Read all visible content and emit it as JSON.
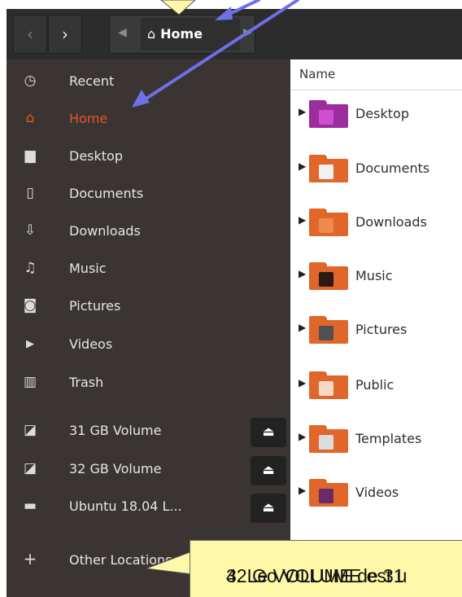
{
  "header": {
    "back_icon": "chevron-left-icon",
    "back_glyph": "‹",
    "forward_icon": "chevron-right-icon",
    "forward_glyph": "›",
    "path_left_glyph": "◀",
    "path_right_glyph": "▶",
    "home_icon": "home-icon",
    "home_glyph": "⌂",
    "current_location": "Home"
  },
  "sidebar": {
    "items": [
      {
        "label": "Recent",
        "icon": "clock-icon",
        "glyph": "◷"
      },
      {
        "label": "Home",
        "icon": "home-icon",
        "glyph": "⌂",
        "active": true
      },
      {
        "label": "Desktop",
        "icon": "desktop-folder-icon",
        "glyph": "▆"
      },
      {
        "label": "Documents",
        "icon": "document-icon",
        "glyph": "▯"
      },
      {
        "label": "Downloads",
        "icon": "download-icon",
        "glyph": "⇩"
      },
      {
        "label": "Music",
        "icon": "music-icon",
        "glyph": "♫"
      },
      {
        "label": "Pictures",
        "icon": "camera-icon",
        "glyph": "◙"
      },
      {
        "label": "Videos",
        "icon": "video-icon",
        "glyph": "▶"
      },
      {
        "label": "Trash",
        "icon": "trash-icon",
        "glyph": "▥"
      }
    ],
    "devices": [
      {
        "label": "31 GB Volume",
        "icon": "drive-icon",
        "glyph": "◪",
        "eject_icon": "eject-icon",
        "eject_glyph": "⏏"
      },
      {
        "label": "32 GB Volume",
        "icon": "drive-icon",
        "glyph": "◪",
        "eject_icon": "eject-icon",
        "eject_glyph": "⏏"
      },
      {
        "label": "Ubuntu 18.04 L...",
        "icon": "optical-drive-icon",
        "glyph": "▬",
        "eject_icon": "eject-icon",
        "eject_glyph": "⏏"
      }
    ],
    "other_locations": {
      "label": "Other Locations",
      "icon": "plus-icon",
      "glyph": "+"
    }
  },
  "filelist": {
    "column_name": "Name",
    "expander_glyph": "▶",
    "rows": [
      {
        "name": "Desktop",
        "icon": "desktop-folder-icon",
        "color": "#9b2d9e",
        "accent": "#d04fd0"
      },
      {
        "name": "Documents",
        "icon": "documents-folder-icon",
        "color": "#e0662a",
        "accent": "#f1f1f1"
      },
      {
        "name": "Downloads",
        "icon": "downloads-folder-icon",
        "color": "#e0662a",
        "accent": "#f08a4a"
      },
      {
        "name": "Music",
        "icon": "music-folder-icon",
        "color": "#e0662a",
        "accent": "#2a1a12"
      },
      {
        "name": "Pictures",
        "icon": "pictures-folder-icon",
        "color": "#e0662a",
        "accent": "#505050"
      },
      {
        "name": "Public",
        "icon": "public-folder-icon",
        "color": "#e0662a",
        "accent": "#f5d9c4"
      },
      {
        "name": "Templates",
        "icon": "templates-folder-icon",
        "color": "#e0662a",
        "accent": "#dcdcdc"
      },
      {
        "name": "Videos",
        "icon": "videos-folder-icon",
        "color": "#e0662a",
        "accent": "#6a2a6a"
      }
    ]
  },
  "annotation": {
    "line1": "4. Le VOLUME de 31",
    "line2": "32 Go VOLUME est u"
  },
  "colors": {
    "accent": "#e95420",
    "sidebar_bg": "#3a3533",
    "header_bg": "#2c2c2c",
    "callout_bg": "#fff8a8",
    "arrow": "#6f6fe8"
  }
}
